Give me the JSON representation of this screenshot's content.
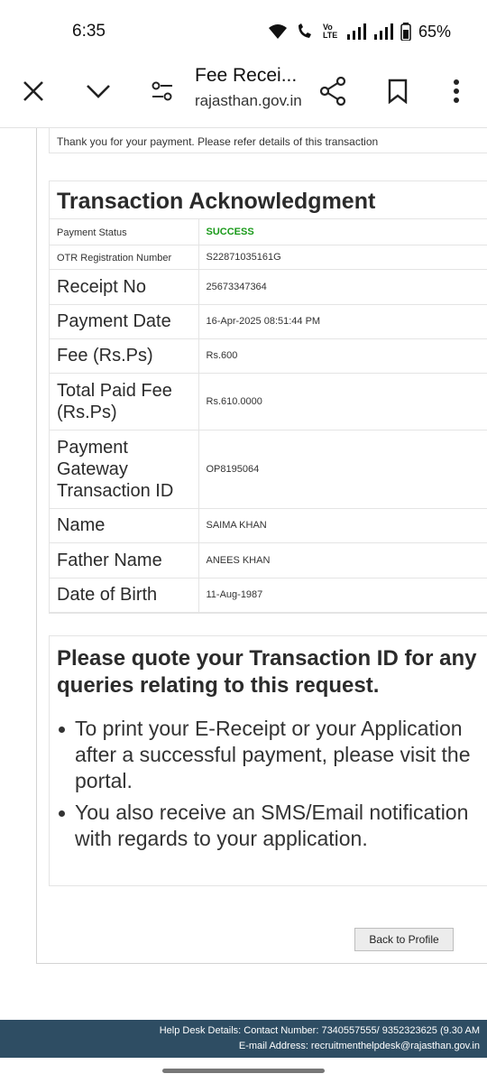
{
  "status_bar": {
    "time": "6:35",
    "battery": "65%",
    "volte": "Vo LTE"
  },
  "toolbar": {
    "title": "Fee Recei...",
    "url": "rajasthan.gov.in"
  },
  "page": {
    "thanks_text": "Thank you for your payment. Please refer details of this transaction",
    "ack_title": "Transaction Acknowledgment",
    "rows": [
      {
        "label": "Payment Status",
        "value": "SUCCESS"
      },
      {
        "label": "OTR Registration Number",
        "value": "S22871035161G"
      },
      {
        "label": "Receipt No",
        "value": "25673347364"
      },
      {
        "label": "Payment Date",
        "value": "16-Apr-2025 08:51:44 PM"
      },
      {
        "label": "Fee (Rs.Ps)",
        "value": "Rs.600"
      },
      {
        "label": "Total Paid Fee (Rs.Ps)",
        "value": "Rs.610.0000"
      },
      {
        "label": "Payment Gateway Transaction ID",
        "value": "OP8195064"
      },
      {
        "label": "Name",
        "value": "SAIMA KHAN"
      },
      {
        "label": "Father Name",
        "value": "ANEES KHAN"
      },
      {
        "label": "Date of Birth",
        "value": "11-Aug-1987"
      }
    ],
    "info_title": "Please quote your Transaction ID for any queries relating to this request.",
    "info_items": [
      "To print your E-Receipt or your Application after a successful payment, please visit the portal.",
      "You also receive an SMS/Email notification with regards to your application."
    ],
    "back_button": "Back to Profile"
  },
  "footer": {
    "line1": "Help Desk Details: Contact Number: 7340557555/ 9352323625 (9.30 AM",
    "line2": "E-mail Address: recruitmenthelpdesk@rajasthan.gov.in"
  },
  "colors": {
    "success": "#1a9a1a",
    "footer_bg": "#2e4d63"
  }
}
